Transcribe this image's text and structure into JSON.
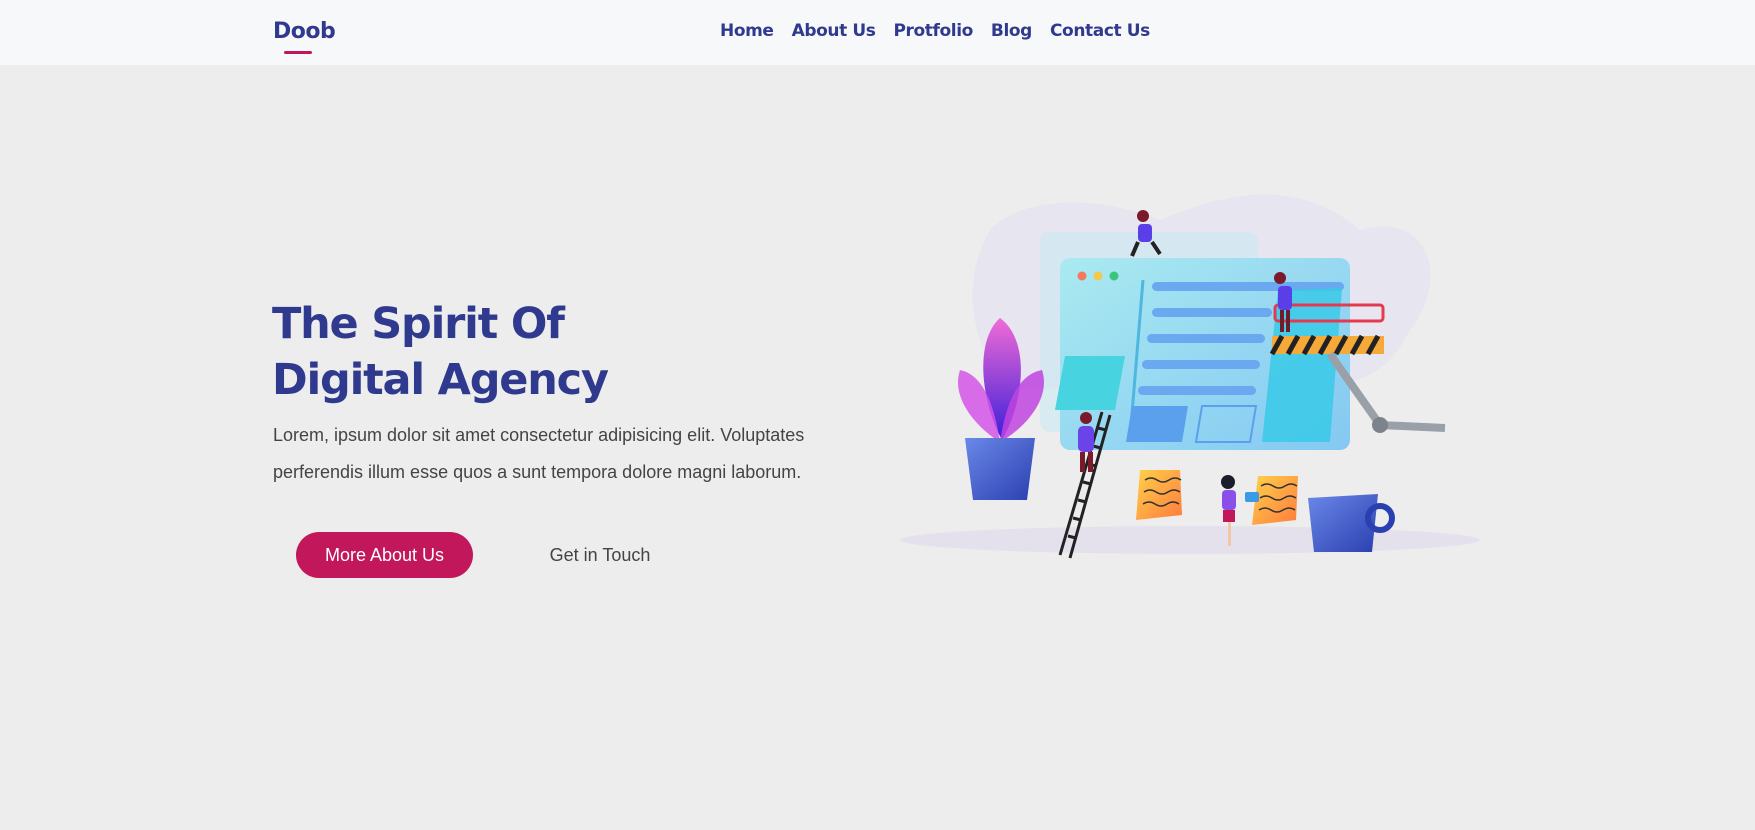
{
  "header": {
    "logo": "Doob",
    "nav": [
      "Home",
      "About Us",
      "Protfolio",
      "Blog",
      "Contact Us"
    ]
  },
  "hero": {
    "title_line1": "The Spirit Of",
    "title_line2": "Digital Agency",
    "description_line1": "Lorem, ipsum dolor sit amet consectetur adipisicing elit. Voluptates",
    "description_line2": "perferendis illum esse quos a sunt tempora dolore magni laborum.",
    "primary_button": "More About Us",
    "secondary_button": "Get in Touch"
  },
  "colors": {
    "brand": "#2f3a8f",
    "accent": "#c2185b",
    "background": "#ededed",
    "header_bg": "#f7f8fa"
  },
  "illustration": {
    "icon": "web-design-team-illustration"
  }
}
